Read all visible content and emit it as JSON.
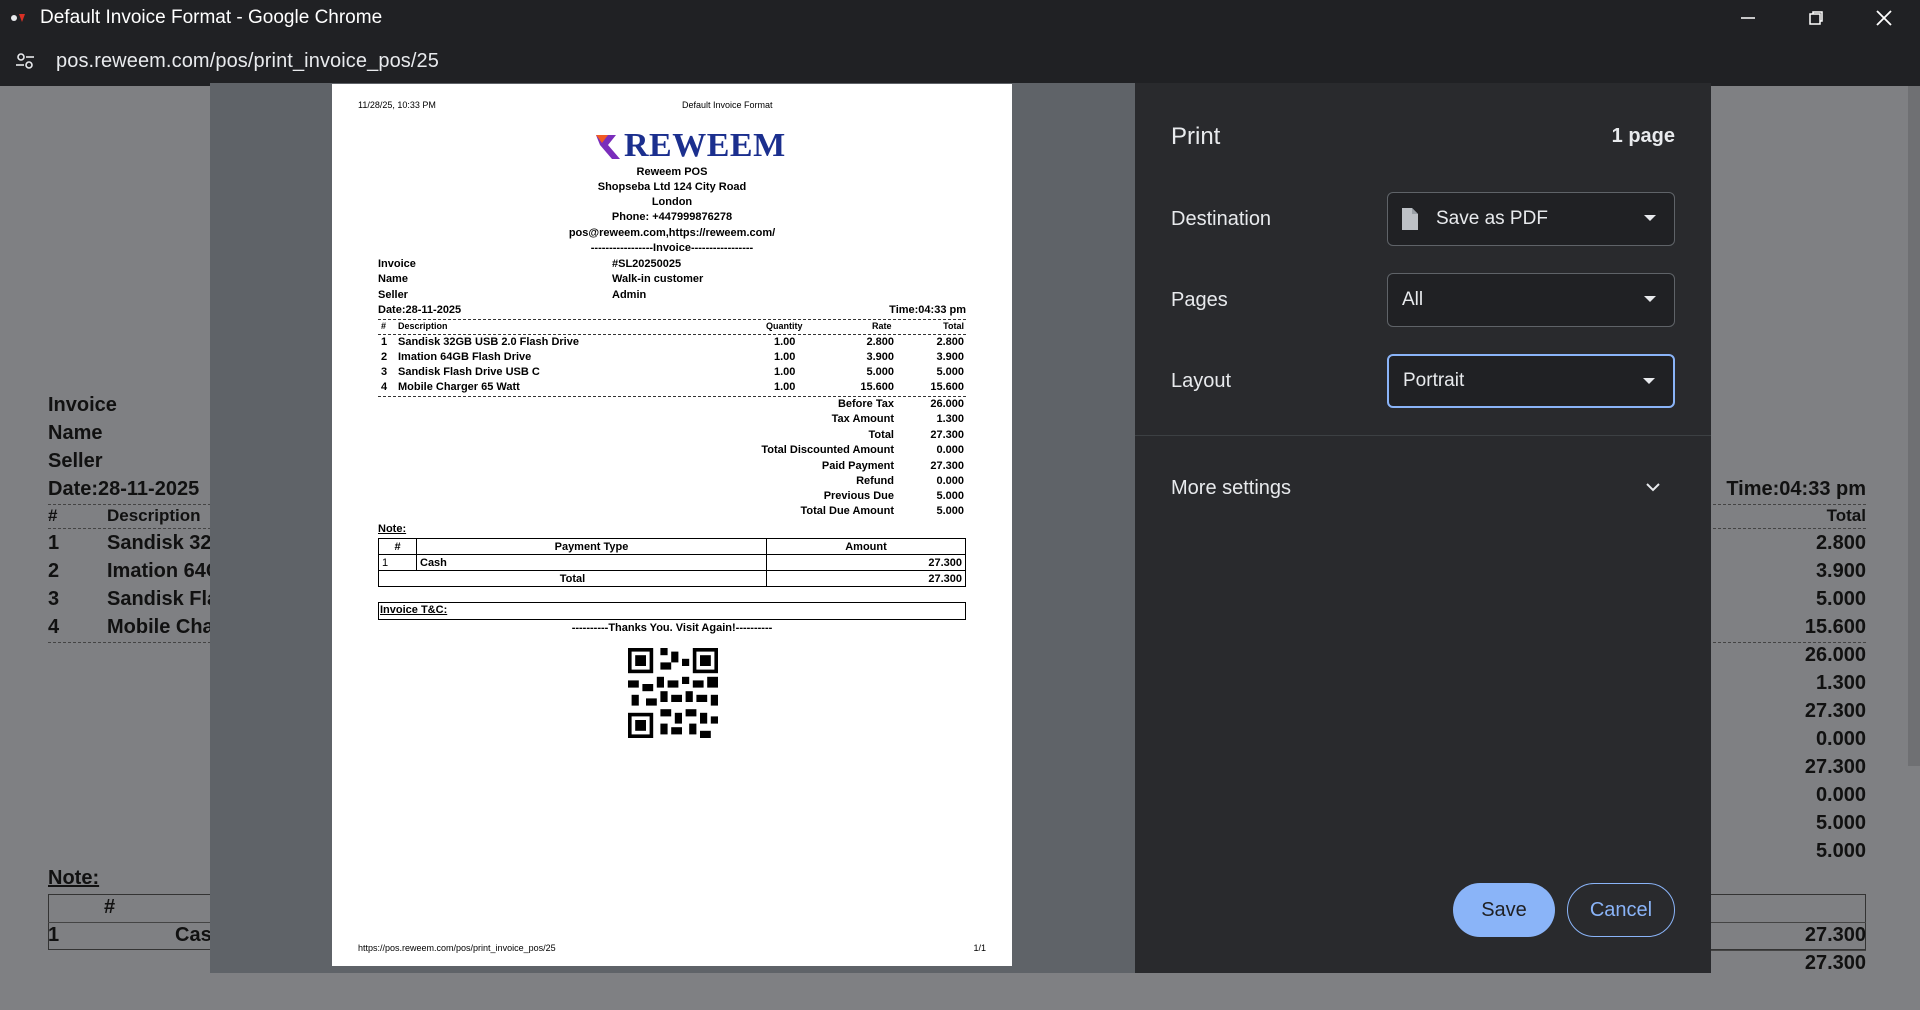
{
  "window": {
    "title": "Default Invoice Format - Google Chrome",
    "url_host": "pos.reweem.com",
    "url_path": "/pos/print_invoice_pos/25"
  },
  "background_page": {
    "labels": [
      "Invoice",
      "Name",
      "Seller",
      "Date:28-11-2025"
    ],
    "time": "Time:04:33 pm",
    "table_header": {
      "num": "#",
      "description": "Description",
      "total": "Total"
    },
    "rows": [
      {
        "num": "1",
        "description": "Sandisk 32"
      },
      {
        "num": "2",
        "description": "Imation 64C"
      },
      {
        "num": "3",
        "description": "Sandisk Fla"
      },
      {
        "num": "4",
        "description": "Mobile Cha"
      }
    ],
    "right_values": [
      "2.800",
      "3.900",
      "5.000",
      "15.600",
      "26.000",
      "1.300",
      "27.300",
      "0.000",
      "27.300",
      "0.000",
      "5.000",
      "5.000"
    ],
    "note": "Note:",
    "payment": {
      "num_header": "#",
      "row_num": "1",
      "row_type": "Cas",
      "amount": "27.300",
      "total": "27.300"
    }
  },
  "preview": {
    "print_datetime": "11/28/25, 10:33 PM",
    "doc_title": "Default Invoice Format",
    "footer_url": "https://pos.reweem.com/pos/print_invoice_pos/25",
    "page_num": "1/1",
    "logo_text": "REWEEM",
    "shop": {
      "name": "Reweem POS",
      "address": "Shopseba Ltd 124 City Road",
      "city": "London",
      "phone": "Phone: +447999876278",
      "contact": "pos@reweem.com,https://reweem.com/",
      "invoice_banner": "-----------------Invoice-----------------"
    },
    "meta": [
      {
        "label": "Invoice",
        "value": "#SL20250025"
      },
      {
        "label": "Name",
        "value": "Walk-in customer"
      },
      {
        "label": "Seller",
        "value": "Admin"
      }
    ],
    "date": "Date:28-11-2025",
    "time": "Time:04:33 pm",
    "items_header": {
      "num": "#",
      "description": "Description",
      "quantity": "Quantity",
      "rate": "Rate",
      "total": "Total"
    },
    "items": [
      {
        "num": "1",
        "description": "Sandisk 32GB USB 2.0 Flash Drive",
        "quantity": "1.00",
        "rate": "2.800",
        "total": "2.800"
      },
      {
        "num": "2",
        "description": "Imation 64GB Flash Drive",
        "quantity": "1.00",
        "rate": "3.900",
        "total": "3.900"
      },
      {
        "num": "3",
        "description": "Sandisk Flash Drive USB C",
        "quantity": "1.00",
        "rate": "5.000",
        "total": "5.000"
      },
      {
        "num": "4",
        "description": "Mobile Charger 65 Watt",
        "quantity": "1.00",
        "rate": "15.600",
        "total": "15.600"
      }
    ],
    "summary": [
      {
        "label": "Before Tax",
        "value": "26.000"
      },
      {
        "label": "Tax Amount",
        "value": "1.300"
      },
      {
        "label": "Total",
        "value": "27.300"
      },
      {
        "label": "Total Discounted Amount",
        "value": "0.000"
      },
      {
        "label": "Paid Payment",
        "value": "27.300"
      },
      {
        "label": "Refund",
        "value": "0.000"
      },
      {
        "label": "Previous Due",
        "value": "5.000"
      },
      {
        "label": "Total Due Amount",
        "value": "5.000"
      }
    ],
    "note": "Note:",
    "payment_table": {
      "headers": {
        "num": "#",
        "type": "Payment Type",
        "amount": "Amount"
      },
      "row": {
        "num": "1",
        "type": "Cash",
        "amount": "27.300"
      },
      "total_label": "Total",
      "total_value": "27.300"
    },
    "tnc": "Invoice T&C:",
    "thanks": "----------Thanks You. Visit Again!----------"
  },
  "print_panel": {
    "title": "Print",
    "page_count": "1 page",
    "destination_label": "Destination",
    "destination_value": "Save as PDF",
    "pages_label": "Pages",
    "pages_value": "All",
    "layout_label": "Layout",
    "layout_value": "Portrait",
    "more_settings": "More settings",
    "save_label": "Save",
    "cancel_label": "Cancel"
  },
  "colors": {
    "accent": "#8ab4f8",
    "panel_bg": "#292a2d",
    "logo_blue": "#1b2f8e"
  }
}
